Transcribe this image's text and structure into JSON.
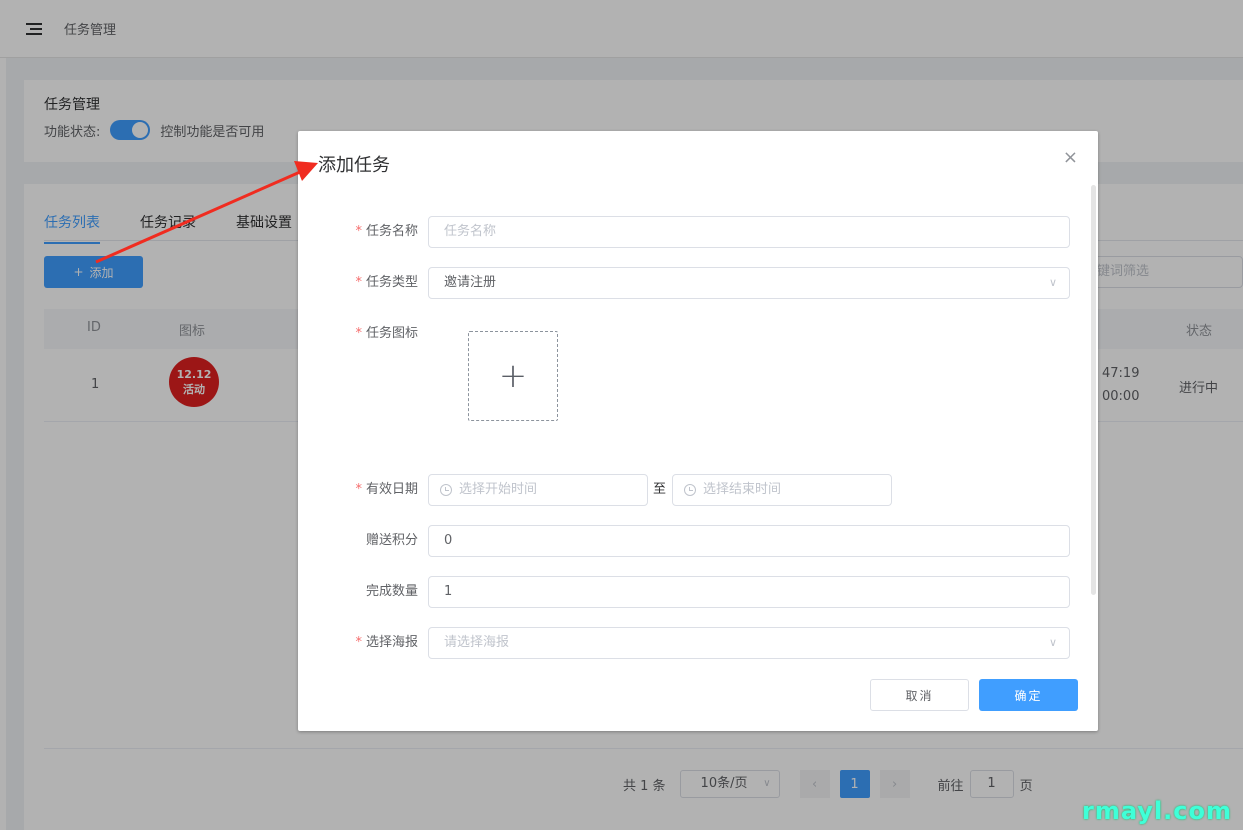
{
  "topbar": {
    "breadcrumb": "任务管理"
  },
  "func_card": {
    "title": "任务管理",
    "status_label": "功能状态:",
    "switch_on": true,
    "switch_desc": "控制功能是否可用"
  },
  "tabs": [
    {
      "label": "任务列表",
      "active": true
    },
    {
      "label": "任务记录",
      "active": false
    },
    {
      "label": "基础设置",
      "active": false
    }
  ],
  "toolbar": {
    "add_label": "添加",
    "filter_placeholder": "键词筛选"
  },
  "table": {
    "headers": {
      "id": "ID",
      "icon": "图标",
      "status": "状态"
    },
    "rows": [
      {
        "id": "1",
        "badge_line1": "12.12",
        "badge_line2": "活动",
        "time1": "47:19",
        "time2": "00:00",
        "status": "进行中"
      }
    ]
  },
  "pager": {
    "total": "共 1 条",
    "page_size": "10条/页",
    "prev": "‹",
    "current": "1",
    "next": "›",
    "goto_label": "前往",
    "goto_value": "1",
    "page_unit": "页"
  },
  "dialog": {
    "title": "添加任务",
    "close": "×",
    "fields": {
      "name_label": "任务名称",
      "name_placeholder": "任务名称",
      "type_label": "任务类型",
      "type_value": "邀请注册",
      "icon_label": "任务图标",
      "upload_plus": "+",
      "date_label": "有效日期",
      "start_placeholder": "选择开始时间",
      "to": "至",
      "end_placeholder": "选择结束时间",
      "points_label": "赠送积分",
      "points_value": "0",
      "count_label": "完成数量",
      "count_value": "1",
      "poster_label": "选择海报",
      "poster_placeholder": "请选择海报"
    },
    "required_mark": "*",
    "cancel_label": "取消",
    "ok_label": "确定"
  },
  "watermark": "rmayl.com",
  "colors": {
    "primary": "#409eff",
    "arrow": "#f02c20",
    "required": "#f56c6c"
  }
}
